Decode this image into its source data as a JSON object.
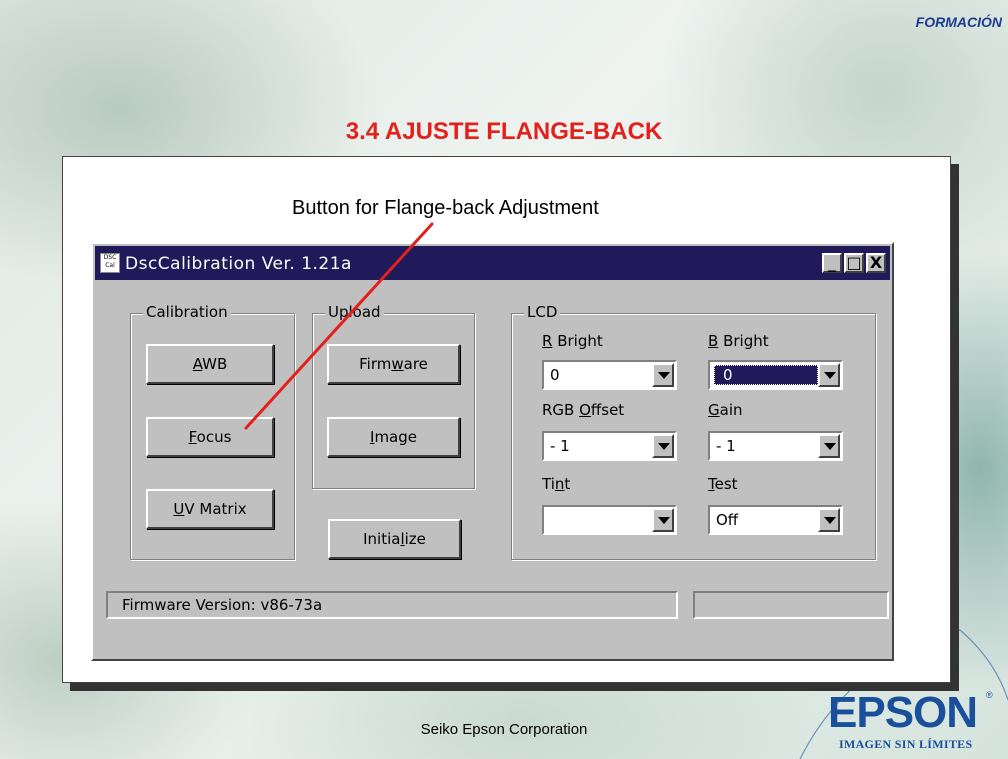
{
  "slide": {
    "header": "FORMACIÓN",
    "title": "3.4 AJUSTE FLANGE-BACK",
    "annotation": "Button for Flange-back Adjustment",
    "footer": "Seiko Epson Corporation",
    "brand": "EPSON",
    "brand_mark": "®",
    "tagline": "IMAGEN SIN LÍMITES"
  },
  "colors": {
    "title": "#e3201c",
    "titlebar": "#201a5a",
    "brand": "#1a4f9c",
    "arrow": "#e3201c"
  },
  "window": {
    "title": "DscCalibration  Ver. 1.21a",
    "icon_text": "DSC Cal",
    "controls": {
      "minimize": "_",
      "maximize": "□",
      "close": "X"
    },
    "calibration": {
      "label": "Calibration",
      "buttons": [
        {
          "pre": "",
          "ul": "A",
          "post": "WB"
        },
        {
          "pre": "",
          "ul": "F",
          "post": "ocus"
        },
        {
          "pre": "",
          "ul": "U",
          "post": "V Matrix"
        }
      ]
    },
    "upload": {
      "label": "Upload",
      "buttons": [
        {
          "pre": "Firm",
          "ul": "w",
          "post": "are"
        },
        {
          "pre": "",
          "ul": "I",
          "post": "mage"
        }
      ]
    },
    "initialize": {
      "pre": "Initia",
      "ul": "l",
      "post": "ize"
    },
    "lcd": {
      "label": "LCD",
      "fields": [
        {
          "pre": "",
          "ul": "R",
          "post": " Bright",
          "value": "0"
        },
        {
          "pre": "",
          "ul": "B",
          "post": " Bright",
          "value": "0"
        },
        {
          "pre": "RGB ",
          "ul": "O",
          "post": "ffset",
          "value": "- 1"
        },
        {
          "pre": "",
          "ul": "G",
          "post": "ain",
          "value": "- 1"
        },
        {
          "pre": "Ti",
          "ul": "n",
          "post": "t",
          "value": ""
        },
        {
          "pre": "",
          "ul": "T",
          "post": "est",
          "value": "Off"
        }
      ]
    },
    "status": {
      "firmware": "Firmware Version: v86-73a",
      "right": ""
    }
  }
}
